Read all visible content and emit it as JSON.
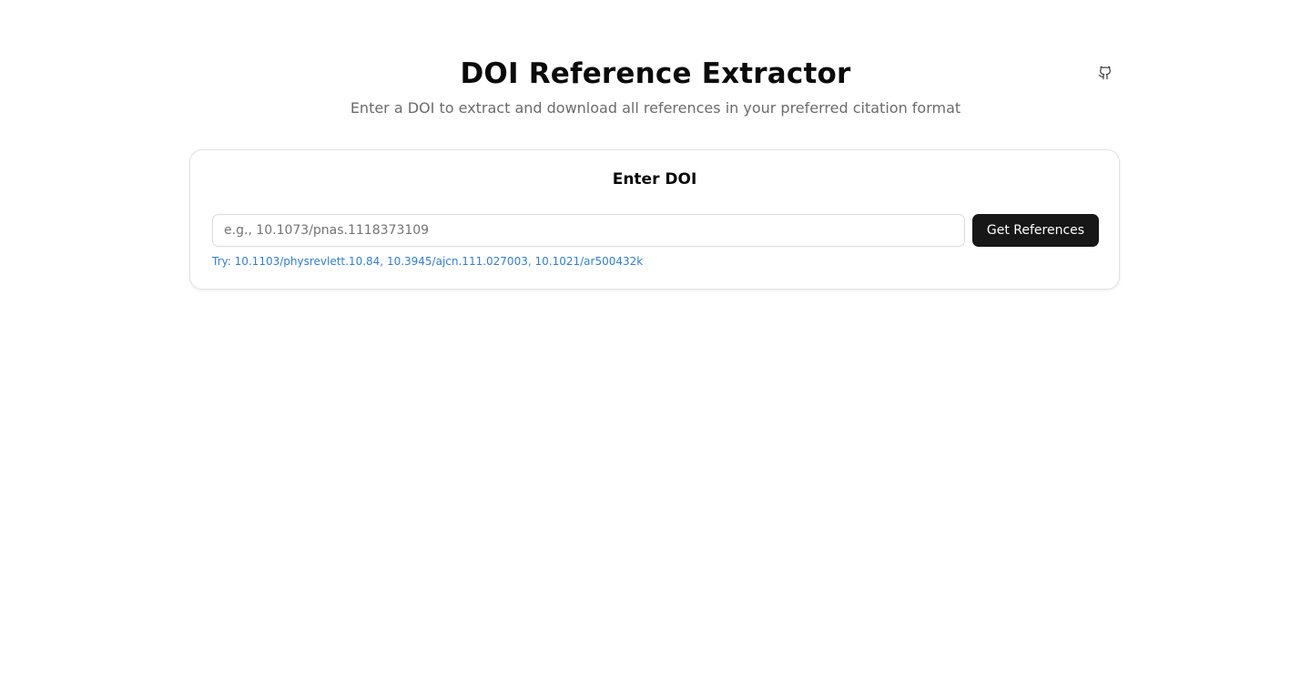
{
  "header": {
    "title": "DOI Reference Extractor",
    "subtitle": "Enter a DOI to extract and download all references in your preferred citation format",
    "github_icon": "github-icon"
  },
  "form": {
    "card_title": "Enter DOI",
    "input_placeholder": "e.g., 10.1073/pnas.1118373109",
    "input_value": "",
    "submit_label": "Get References",
    "examples_prefix": "Try: ",
    "examples": [
      "10.1103/physrevlett.10.84",
      "10.3945/ajcn.111.027003",
      "10.1021/ar500432k"
    ],
    "separator": ", "
  },
  "colors": {
    "button_bg": "#171717",
    "example_link": "#2f7fd6",
    "subtitle": "#6b6b6b"
  }
}
